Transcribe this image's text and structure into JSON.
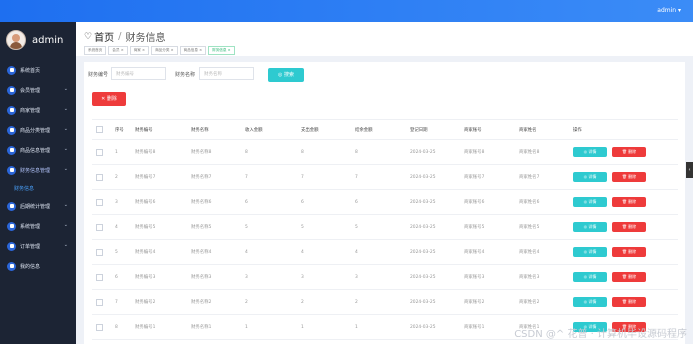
{
  "topbar": {
    "user": "admin ▾"
  },
  "brand": {
    "name": "admin"
  },
  "sidebar": {
    "items": [
      {
        "label": "系统首页",
        "chevron": ""
      },
      {
        "label": "会员管理",
        "chevron": "⌄"
      },
      {
        "label": "商家管理",
        "chevron": "⌄"
      },
      {
        "label": "商品分类管理",
        "chevron": "⌄"
      },
      {
        "label": "商品信息管理",
        "chevron": "⌄"
      },
      {
        "label": "财务信息管理",
        "chevron": "⌄"
      },
      {
        "label": "后期统计管理",
        "chevron": "⌄"
      },
      {
        "label": "系统管理",
        "chevron": "⌄"
      },
      {
        "label": "订单管理",
        "chevron": "⌄"
      },
      {
        "label": "我的信息",
        "chevron": ""
      }
    ],
    "sub_item": "财务信息"
  },
  "breadcrumb": {
    "home": "首页",
    "separator": "/",
    "current": "财务信息"
  },
  "tags": [
    "系统首页",
    "会员 ×",
    "商家 ×",
    "商品分类 ×",
    "商品信息 ×",
    "财务信息 ×"
  ],
  "filters": {
    "label1": "财务编号",
    "placeholder1": "财务编号",
    "label2": "财务名称",
    "placeholder2": "财务名称",
    "search_btn": "◎ 搜索"
  },
  "delete_btn": "✕ 删除",
  "table": {
    "headers": [
      "",
      "序号",
      "财务编号",
      "财务名称",
      "收入金额",
      "支出金额",
      "结余金额",
      "登记日期",
      "商家账号",
      "商家姓名",
      "操作"
    ],
    "rows": [
      [
        "1",
        "财务编号8",
        "财务名称8",
        "8",
        "8",
        "8",
        "2024-03-25",
        "商家账号8",
        "商家姓名8"
      ],
      [
        "2",
        "财务编号7",
        "财务名称7",
        "7",
        "7",
        "7",
        "2024-03-25",
        "商家账号7",
        "商家姓名7"
      ],
      [
        "3",
        "财务编号6",
        "财务名称6",
        "6",
        "6",
        "6",
        "2024-03-25",
        "商家账号6",
        "商家姓名6"
      ],
      [
        "4",
        "财务编号5",
        "财务名称5",
        "5",
        "5",
        "5",
        "2024-03-25",
        "商家账号5",
        "商家姓名5"
      ],
      [
        "5",
        "财务编号4",
        "财务名称4",
        "4",
        "4",
        "4",
        "2024-03-25",
        "商家账号4",
        "商家姓名4"
      ],
      [
        "6",
        "财务编号3",
        "财务名称3",
        "3",
        "3",
        "3",
        "2024-03-25",
        "商家账号3",
        "商家姓名3"
      ],
      [
        "7",
        "财务编号2",
        "财务名称2",
        "2",
        "2",
        "2",
        "2024-03-25",
        "商家账号2",
        "商家姓名2"
      ],
      [
        "8",
        "财务编号1",
        "财务名称1",
        "1",
        "1",
        "1",
        "2024-03-25",
        "商家账号1",
        "商家姓名1"
      ]
    ],
    "detail_btn": "◎ 详情",
    "delete_row_btn": "🗑 删除"
  },
  "side_handle": "‹",
  "watermark": "CSDN @^ 花普 · 计算机毕设源码程序",
  "colors": {
    "accent": "#2ecad0",
    "danger": "#ee3b3b",
    "sidebar": "#1c2434",
    "topbar": "#1e6ff0"
  }
}
